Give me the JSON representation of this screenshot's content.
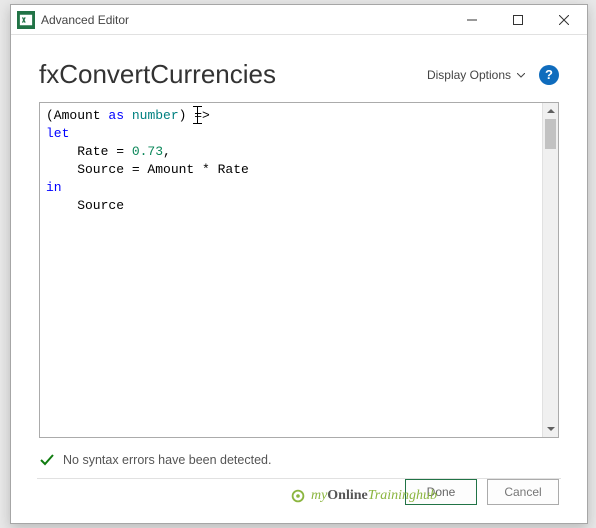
{
  "window": {
    "title": "Advanced Editor"
  },
  "header": {
    "query_name": "fxConvertCurrencies",
    "display_options_label": "Display Options",
    "help_glyph": "?"
  },
  "code": {
    "line1_open": "(Amount ",
    "line1_as": "as",
    "line1_space": " ",
    "line1_type": "number",
    "line1_close": ") =>",
    "line2_let": "let",
    "line3_prefix": "    Rate = ",
    "line3_num": "0.73",
    "line3_suffix": ",",
    "line4": "    Source = Amount * Rate",
    "line5_in": "in",
    "line6": "    Source"
  },
  "status": {
    "message": "No syntax errors have been detected."
  },
  "buttons": {
    "done": "Done",
    "cancel": "Cancel"
  },
  "watermark": {
    "prefix": "my",
    "mid": "Online",
    "suffix": "Traininghub"
  }
}
